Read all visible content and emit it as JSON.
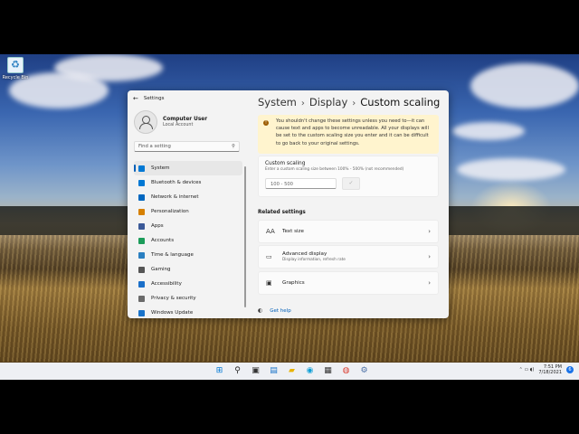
{
  "desktop": {
    "recycle_bin_label": "Recycle Bin"
  },
  "window": {
    "app_title": "Settings",
    "back_glyph": "←",
    "controls": [
      "—",
      "☐",
      "✕"
    ]
  },
  "profile": {
    "name": "Computer User",
    "account_type": "Local Account"
  },
  "search": {
    "placeholder": "Find a setting",
    "icon": "search-icon"
  },
  "nav": {
    "items": [
      {
        "label": "System",
        "icon": "display-icon",
        "color": "#0078d4",
        "active": true
      },
      {
        "label": "Bluetooth & devices",
        "icon": "bluetooth-icon",
        "color": "#0078d4"
      },
      {
        "label": "Network & internet",
        "icon": "wifi-icon",
        "color": "#0067c0"
      },
      {
        "label": "Personalization",
        "icon": "brush-icon",
        "color": "#d68000"
      },
      {
        "label": "Apps",
        "icon": "apps-icon",
        "color": "#3b5998"
      },
      {
        "label": "Accounts",
        "icon": "person-icon",
        "color": "#1c9c5a"
      },
      {
        "label": "Time & language",
        "icon": "clock-icon",
        "color": "#2a7fc1"
      },
      {
        "label": "Gaming",
        "icon": "controller-icon",
        "color": "#555555"
      },
      {
        "label": "Accessibility",
        "icon": "accessibility-icon",
        "color": "#1a6fc9"
      },
      {
        "label": "Privacy & security",
        "icon": "shield-icon",
        "color": "#6a6a6a"
      },
      {
        "label": "Windows Update",
        "icon": "update-icon",
        "color": "#1a73c9"
      }
    ]
  },
  "breadcrumb": {
    "part1": "System",
    "part2": "Display",
    "part3": "Custom scaling",
    "sep": "›"
  },
  "warning": {
    "icon": "!",
    "text": "You shouldn't change these settings unless you need to—it can cause text and apps to become unreadable. All your displays will be set to the custom scaling size you enter and it can be difficult to go back to your original settings."
  },
  "custom_scaling": {
    "title": "Custom scaling",
    "subtitle": "Enter a custom scaling size between 100% - 500% (not recommended)",
    "input_placeholder": "100 - 500",
    "apply_glyph": "✓"
  },
  "related": {
    "heading": "Related settings",
    "items": [
      {
        "title": "Text size",
        "subtitle": "",
        "icon_glyph": "AA",
        "icon": "text-size-icon"
      },
      {
        "title": "Advanced display",
        "subtitle": "Display information, refresh rate",
        "icon_glyph": "▭",
        "icon": "monitor-icon"
      },
      {
        "title": "Graphics",
        "subtitle": "",
        "icon_glyph": "▣",
        "icon": "graphics-icon"
      }
    ],
    "chevron": "›"
  },
  "help": {
    "label": "Get help",
    "icon_glyph": "◐"
  },
  "taskbar": {
    "apps": [
      {
        "icon": "windows-start-icon",
        "glyph": "⊞",
        "color": "#0078d4"
      },
      {
        "icon": "search-icon",
        "glyph": "⚲",
        "color": "#222222"
      },
      {
        "icon": "task-view-icon",
        "glyph": "▣",
        "color": "#333333"
      },
      {
        "icon": "widgets-icon",
        "glyph": "▤",
        "color": "#1a73c9"
      },
      {
        "icon": "file-explorer-icon",
        "glyph": "▰",
        "color": "#e8b200"
      },
      {
        "icon": "edge-icon",
        "glyph": "◉",
        "color": "#0c9ed6"
      },
      {
        "icon": "store-icon",
        "glyph": "▦",
        "color": "#333333"
      },
      {
        "icon": "chrome-icon",
        "glyph": "◍",
        "color": "#db4437"
      },
      {
        "icon": "settings-gear-icon",
        "glyph": "⚙",
        "color": "#4a6fa5"
      }
    ],
    "time": "7:51 PM",
    "date": "7/18/2021",
    "tray_glyphs": "⌃ ▭ ◖)",
    "notification_count": "6"
  }
}
